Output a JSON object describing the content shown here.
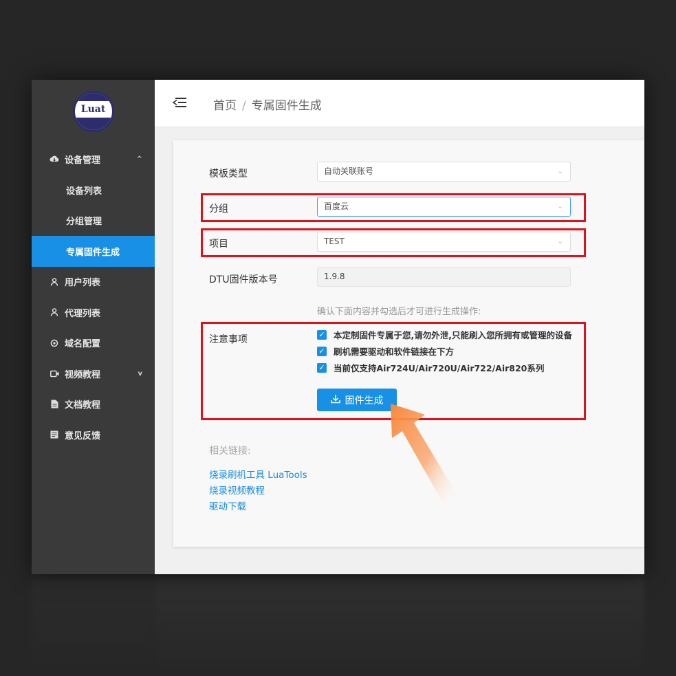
{
  "sidebar": {
    "logo_text": "Luat",
    "group": {
      "label": "设备管理",
      "children": [
        "设备列表",
        "分组管理",
        "专属固件生成"
      ]
    },
    "items": [
      {
        "label": "用户列表",
        "icon": "user-icon"
      },
      {
        "label": "代理列表",
        "icon": "user-icon"
      },
      {
        "label": "域名配置",
        "icon": "settings-icon"
      },
      {
        "label": "视频教程",
        "icon": "video-icon"
      },
      {
        "label": "文档教程",
        "icon": "document-icon"
      },
      {
        "label": "意见反馈",
        "icon": "feedback-icon"
      }
    ],
    "active": "专属固件生成"
  },
  "header": {
    "breadcrumb": [
      "首页",
      "专属固件生成"
    ],
    "separator": "/"
  },
  "form": {
    "template_type": {
      "label": "模板类型",
      "value": "自动关联账号"
    },
    "group": {
      "label": "分组",
      "value": "百度云"
    },
    "project": {
      "label": "项目",
      "value": "TEST"
    },
    "dtu_version": {
      "label": "DTU固件版本号",
      "value": "1.9.8"
    },
    "hint": "确认下面内容并勾选后才可进行生成操作:",
    "notes": {
      "label": "注意事项",
      "items": [
        "本定制固件专属于您,请勿外泄,只能刷入您所拥有或管理的设备",
        "刷机需要驱动和软件链接在下方",
        "当前仅支持Air724U/Air720U/Air722/Air820系列"
      ]
    },
    "generate_button": "固件生成"
  },
  "links": {
    "title": "相关链接:",
    "items": [
      "烧录刷机工具 LuaTools",
      "烧录视频教程",
      "驱动下载"
    ]
  },
  "colors": {
    "accent": "#1890e6",
    "highlight": "#e3101a",
    "sidebar": "#3a3a3a",
    "arrow": "#f7893b"
  }
}
